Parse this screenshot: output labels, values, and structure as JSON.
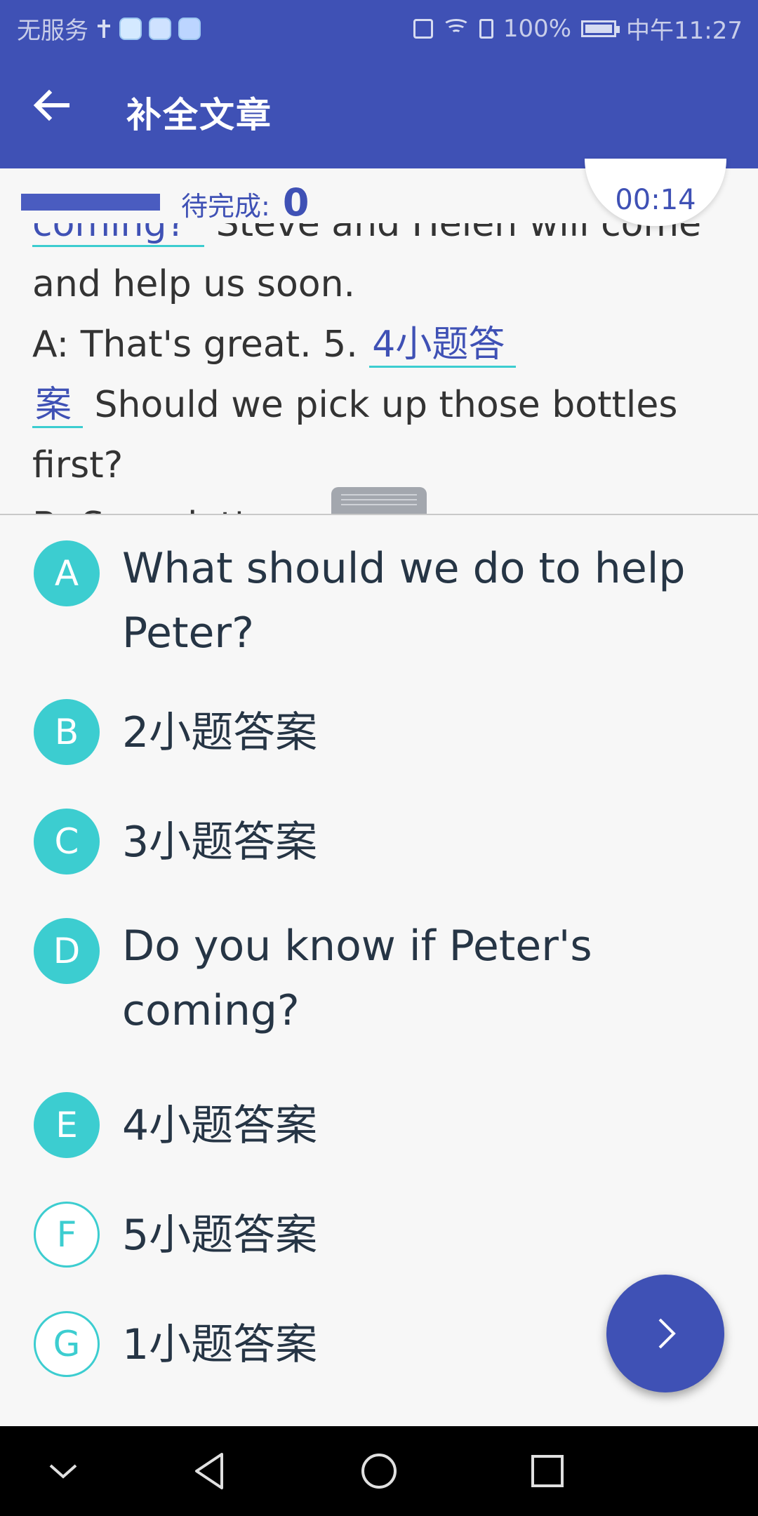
{
  "status_bar": {
    "carrier": "无服务",
    "battery": "100%",
    "time": "中午11:27",
    "icons": [
      "usb-icon",
      "app-icon",
      "app-icon",
      "app-icon",
      "vibrate-icon",
      "wifi-icon",
      "sim-icon",
      "battery-icon"
    ]
  },
  "app_bar": {
    "title": "补全文章",
    "back_icon": "arrow-left-icon"
  },
  "progress": {
    "pending_label": "待完成:",
    "pending_count": "0",
    "fill_fraction": 1.0,
    "timer": "00:14"
  },
  "passage": {
    "line1_answer": "coming?",
    "line1_text": "Steve and Helen will come",
    "line2_text": "and help us soon.",
    "line3_text": "A: That's great.  5.",
    "line3_answer": "4小题答",
    "line4_answer": "案",
    "line4_text": "Should we pick up those bottles",
    "line5_text": "first?",
    "line6_text": "B: Sure. let's go"
  },
  "options": [
    {
      "letter": "A",
      "text": "What should we do to help Peter?",
      "used": true
    },
    {
      "letter": "B",
      "text": "2小题答案",
      "used": true
    },
    {
      "letter": "C",
      "text": "3小题答案",
      "used": true
    },
    {
      "letter": "D",
      "text": "Do you know if Peter's coming?",
      "used": true
    },
    {
      "letter": "E",
      "text": "4小题答案",
      "used": true
    },
    {
      "letter": "F",
      "text": "5小题答案",
      "used": false
    },
    {
      "letter": "G",
      "text": "1小题答案",
      "used": false
    }
  ],
  "fab": {
    "icon": "chevron-right-icon"
  },
  "nav_bar": {
    "icons": [
      "chevron-down-icon",
      "back-triangle-icon",
      "home-circle-icon",
      "recents-square-icon"
    ]
  },
  "colors": {
    "primary": "#3f51b5",
    "accent": "#3ccdd0",
    "text": "#263545"
  }
}
